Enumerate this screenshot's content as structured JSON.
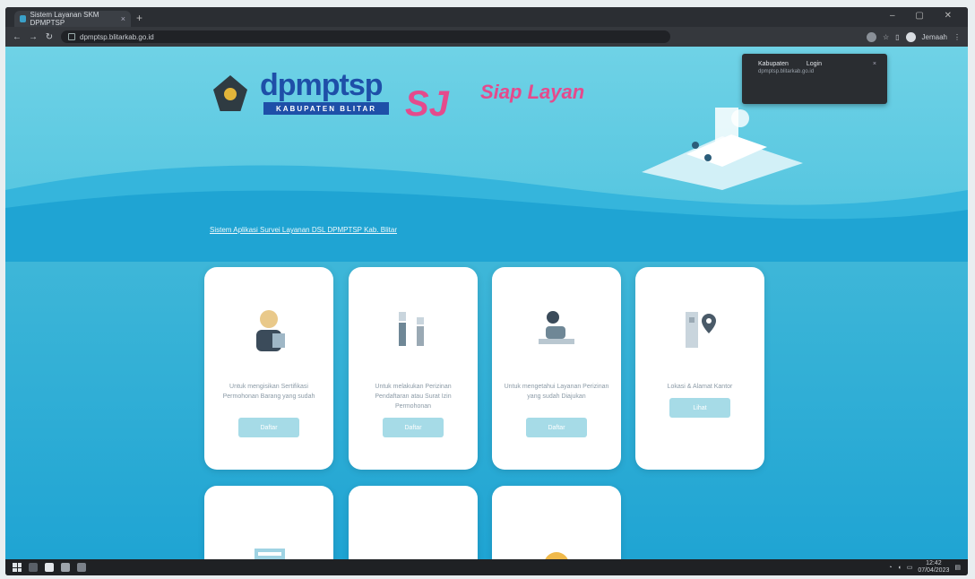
{
  "browser": {
    "tab_title": "Sistem Layanan SKM DPMPTSP",
    "tab_close": "×",
    "new_tab": "+",
    "window_controls": "–  ▢  ✕",
    "url": "dpmptsp.blitarkab.go.id",
    "profile_name": "Jemaah"
  },
  "header": {
    "logo_text": "dpmptsp",
    "logo_sub": "KABUPATEN BLITAR",
    "brand_mark": "SJ",
    "brand_slogan": "Siap Layan"
  },
  "dropdown": {
    "item1": "Kabupaten",
    "item2": "Login",
    "close": "×",
    "sub": "dpmptsp.blitarkab.go.id"
  },
  "intro": "Sistem Aplikasi Survei Layanan DSL DPMPTSP Kab. Blitar",
  "cards": [
    {
      "desc": "Untuk mengisikan Sertifikasi Permohonan Barang yang sudah",
      "button": "Daftar"
    },
    {
      "desc": "Untuk melakukan Perizinan Pendaftaran atau Surat Izin Permohonan",
      "button": "Daftar"
    },
    {
      "desc": "Untuk mengetahui Layanan Perizinan yang sudah Diajukan",
      "button": "Daftar"
    },
    {
      "desc": "Lokasi & Alamat Kantor",
      "button": "Lihat"
    }
  ],
  "taskbar": {
    "time": "12:42",
    "date": "07/04/2023"
  },
  "colors": {
    "accent": "#3fb7d8",
    "brand_blue": "#1e4fa8",
    "brand_pink": "#e54a8c",
    "button": "#a6dbe7"
  }
}
